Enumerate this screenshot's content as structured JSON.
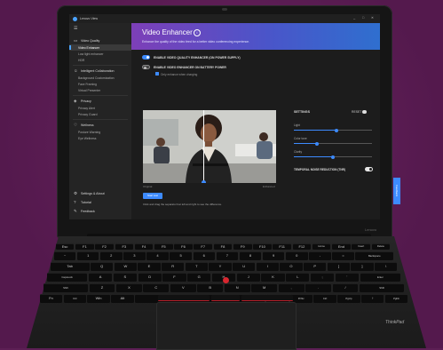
{
  "app": {
    "title": "Lenovo View"
  },
  "window_controls": {
    "minimize": "–",
    "maximize": "□",
    "close": "✕"
  },
  "sidebar": {
    "menu_icon": "hamburger-icon",
    "sections": [
      {
        "label": "Video Quality",
        "icon": "camera-icon",
        "items": [
          {
            "label": "Video Enhancer",
            "active": true
          },
          {
            "label": "Low light enhancer"
          },
          {
            "label": "HDR"
          }
        ]
      },
      {
        "label": "Intelligent Collaboration",
        "icon": "people-icon",
        "items": [
          {
            "label": "Background Customization"
          },
          {
            "label": "Face Framing"
          },
          {
            "label": "Virtual Presenter"
          }
        ]
      },
      {
        "label": "Privacy",
        "icon": "shield-icon",
        "items": [
          {
            "label": "Privacy Alert"
          },
          {
            "label": "Privacy Guard"
          }
        ]
      },
      {
        "label": "Wellness",
        "icon": "heart-icon",
        "items": [
          {
            "label": "Posture Warning"
          },
          {
            "label": "Eye Wellness"
          }
        ]
      }
    ],
    "footer": [
      {
        "label": "Settings & About",
        "icon": "gear-icon"
      },
      {
        "label": "Tutorial",
        "icon": "help-icon"
      },
      {
        "label": "Feedback",
        "icon": "feedback-icon"
      }
    ]
  },
  "hero": {
    "title": "Video Enhancer",
    "subtitle": "Enhance the quality of the video feed for a better video conferencing experience."
  },
  "options": [
    {
      "label": "ENABLE VIDEO QUALITY ENHANCER (ON POWER SUPPLY)",
      "on": true
    },
    {
      "label": "ENABLE VIDEO ENHANCER ON BATTERY POWER",
      "on": false,
      "checkbox": "Only enhance when charging"
    }
  ],
  "preview": {
    "before_caption": "Original",
    "after_caption": "Enhanced"
  },
  "primary_button": "Start test",
  "hint": "Click and drag the separator bar left and right to see the difference.",
  "settings": {
    "title": "SETTINGS",
    "reset": "RESET",
    "sliders": [
      {
        "label": "Light",
        "value": 0.55
      },
      {
        "label": "Color tone",
        "value": 0.3
      },
      {
        "label": "Clarity",
        "value": 0.5
      }
    ],
    "temporal_label": "TEMPORAL NOISE REDUCTION (TNR)",
    "temporal_on": true
  },
  "feedback_tab": "Feedback",
  "hardware": {
    "bezel_brand": "Lenovo",
    "keyboard_brand": "ThinkPad",
    "keyboard_rows": [
      [
        "Esc",
        "F1",
        "F2",
        "F3",
        "F4",
        "F5",
        "F6",
        "F7",
        "F8",
        "F9",
        "F10",
        "F11",
        "F12",
        "Home",
        "End",
        "Insert",
        "Delete"
      ],
      [
        "~",
        "1",
        "2",
        "3",
        "4",
        "5",
        "6",
        "7",
        "8",
        "9",
        "0",
        "-",
        "=",
        "Backspace"
      ],
      [
        "Tab",
        "Q",
        "W",
        "E",
        "R",
        "T",
        "Y",
        "U",
        "I",
        "O",
        "P",
        "[",
        "]",
        "\\"
      ],
      [
        "CapsLock",
        "A",
        "S",
        "D",
        "F",
        "G",
        "H",
        "J",
        "K",
        "L",
        ";",
        "'",
        "Enter"
      ],
      [
        "Shift",
        "Z",
        "X",
        "C",
        "V",
        "B",
        "N",
        "M",
        ",",
        ".",
        "/",
        "Shift"
      ],
      [
        "Fn",
        "Ctrl",
        "Win",
        "Alt",
        "",
        "Alt",
        "PrtSc",
        "Ctrl",
        "PgUp",
        "↑",
        "PgDn"
      ]
    ]
  }
}
